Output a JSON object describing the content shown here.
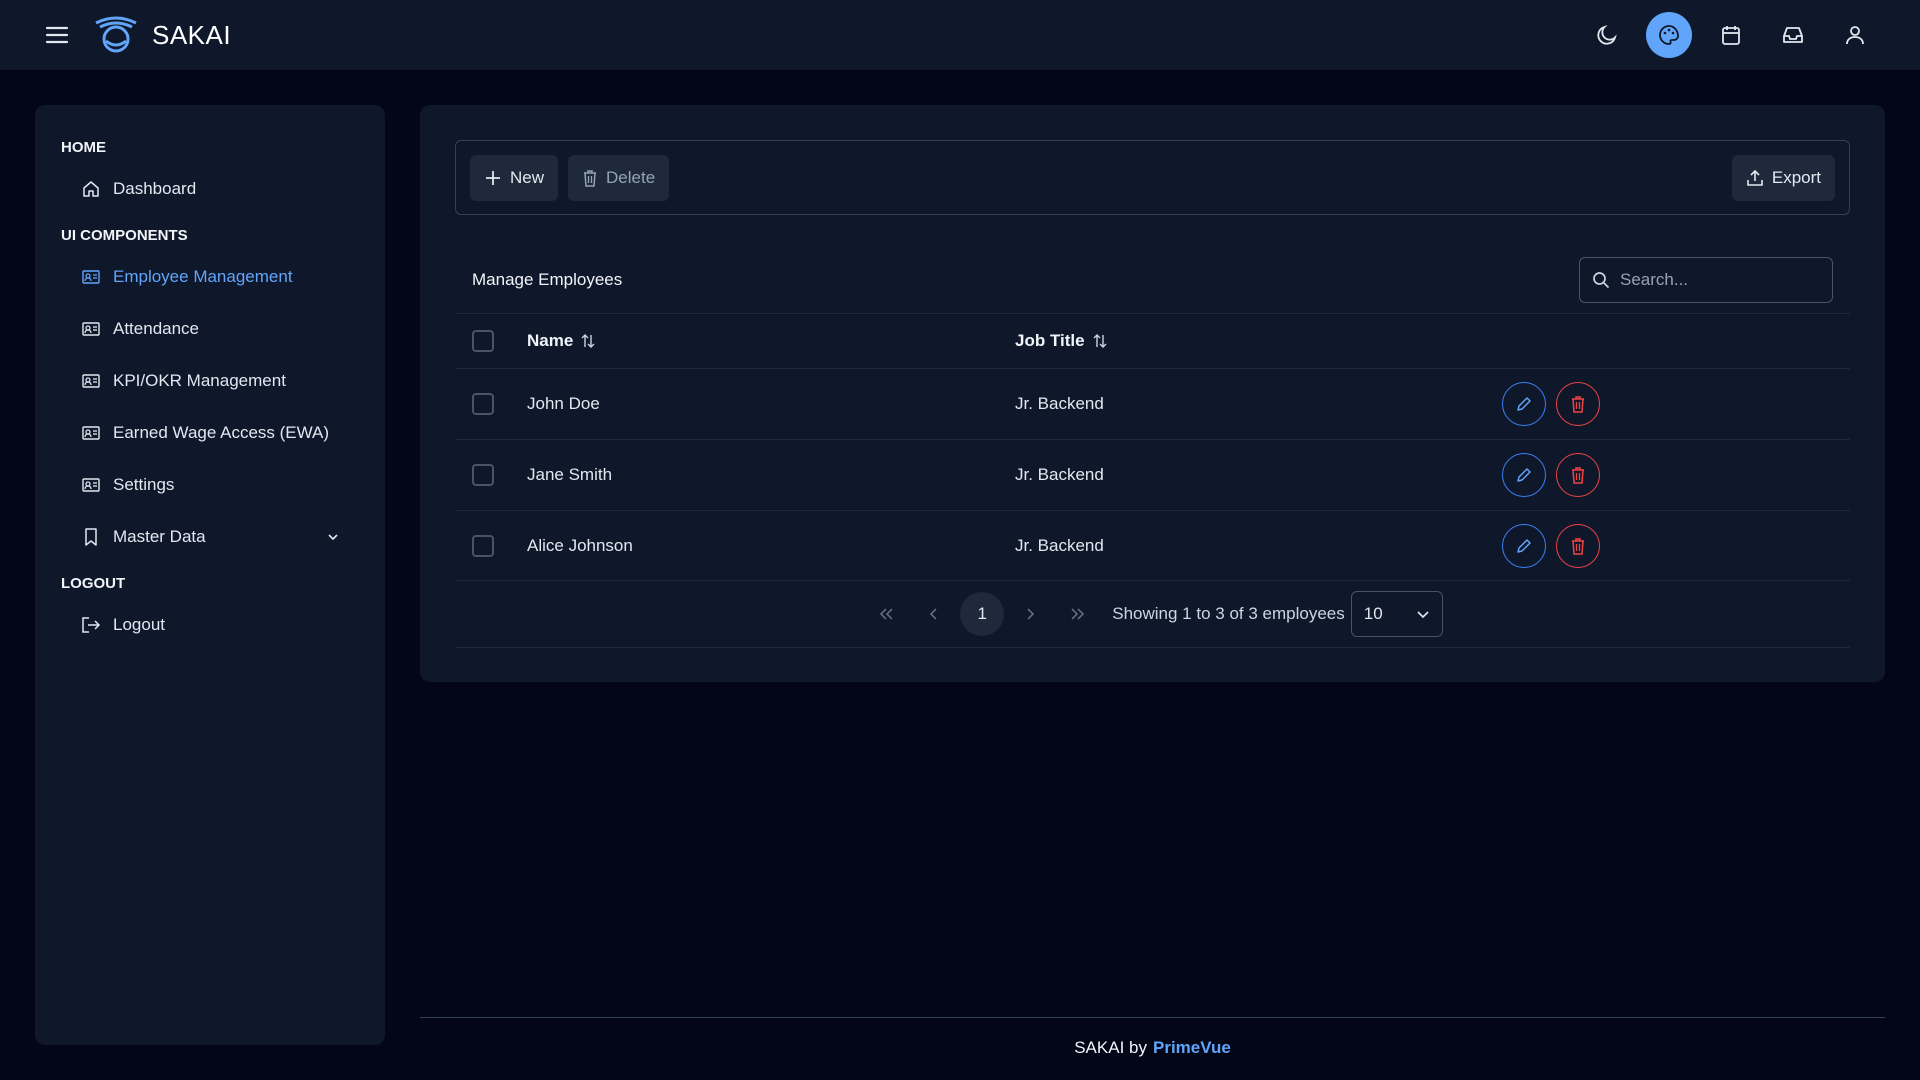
{
  "app": {
    "brand": "SAKAI",
    "accent_color": "#60a5fa"
  },
  "topbar": {
    "icons": [
      "menu-icon",
      "moon-icon",
      "palette-icon",
      "calendar-icon",
      "inbox-icon",
      "user-icon"
    ]
  },
  "sidebar": {
    "sections": [
      {
        "title": "HOME"
      },
      {
        "title": "UI COMPONENTS"
      },
      {
        "title": "LOGOUT"
      }
    ],
    "items": [
      {
        "label": "Dashboard",
        "icon": "home-icon"
      },
      {
        "label": "Employee Management",
        "icon": "id-card-icon",
        "active": true
      },
      {
        "label": "Attendance",
        "icon": "id-card-icon"
      },
      {
        "label": "KPI/OKR Management",
        "icon": "id-card-icon"
      },
      {
        "label": "Earned Wage Access (EWA)",
        "icon": "id-card-icon"
      },
      {
        "label": "Settings",
        "icon": "id-card-icon"
      },
      {
        "label": "Master Data",
        "icon": "bookmark-icon"
      },
      {
        "label": "Logout",
        "icon": "sign-out-icon"
      }
    ]
  },
  "toolbar": {
    "new_label": "New",
    "delete_label": "Delete",
    "export_label": "Export"
  },
  "table": {
    "title": "Manage Employees",
    "search_placeholder": "Search...",
    "columns": [
      "Name",
      "Job Title"
    ],
    "rows": [
      {
        "name": "John Doe",
        "job_title": "Jr. Backend"
      },
      {
        "name": "Jane Smith",
        "job_title": "Jr. Backend"
      },
      {
        "name": "Alice Johnson",
        "job_title": "Jr. Backend"
      }
    ]
  },
  "paginator": {
    "current_page": "1",
    "summary": "Showing 1 to 3 of 3 employees",
    "rows_per_page": "10"
  },
  "footer": {
    "text": "SAKAI by",
    "link": "PrimeVue"
  }
}
